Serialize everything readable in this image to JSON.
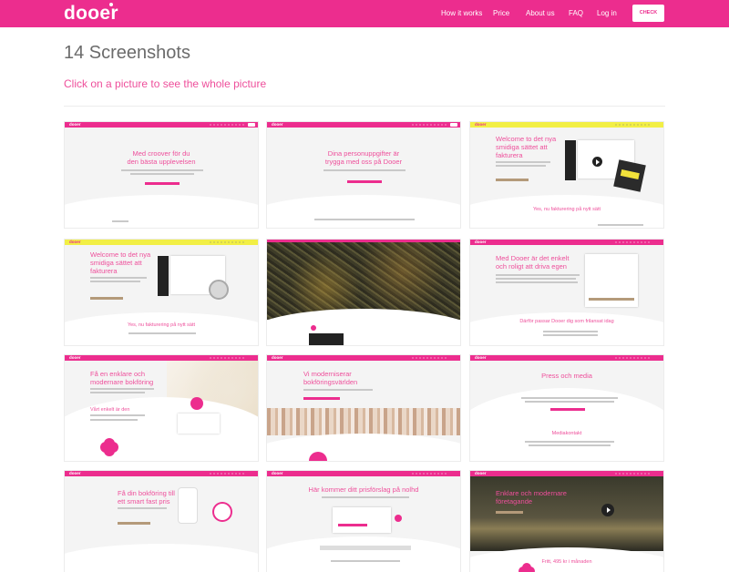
{
  "header": {
    "logo": "dooer",
    "nav": [
      "How it works",
      "Price",
      "About us",
      "FAQ",
      "Log in"
    ],
    "cta": "CHECK"
  },
  "page": {
    "title": "14 Screenshots",
    "subtitle": "Click on a picture to see the whole picture"
  },
  "screenshots": [
    {
      "logo": "dooer",
      "heading": [
        "Med croover för du",
        "den bästa upplevelsen"
      ]
    },
    {
      "logo": "dooer",
      "heading": [
        "Dina personuppgifter är",
        "trygga med oss på Dooer"
      ]
    },
    {
      "logo": "dooer",
      "heading": [
        "Welcome to det nya",
        "smidiga sättet att",
        "fakturera"
      ],
      "footer": "Yes, nu fakturering på nytt sätt"
    },
    {
      "logo": "dooer",
      "heading": [
        "Welcome to det nya",
        "smidiga sättet att",
        "fakturera"
      ],
      "footer": "Yes, nu fakturering på nytt sätt"
    },
    {
      "logo": "dooer",
      "heading": []
    },
    {
      "logo": "dooer",
      "heading": [
        "Med Dooer är det enkelt",
        "och roligt att driva egen"
      ],
      "footer": "Därför passar Dooer dig som frilansat idag"
    },
    {
      "logo": "dooer",
      "heading": [
        "Få en enklare och",
        "modernare bokföring"
      ],
      "footer": "Vårt enkelt är den"
    },
    {
      "logo": "dooer",
      "heading": [
        "Vi moderniserar",
        "bokföringsvärlden"
      ]
    },
    {
      "logo": "dooer",
      "heading": [
        "Press och media"
      ],
      "footer": "Mediakontakt"
    },
    {
      "logo": "dooer",
      "heading": [
        "Få din bokföring till",
        "ett smart fast pris"
      ]
    },
    {
      "logo": "dooer",
      "heading": [
        "Här kommer ditt prisförslag på nolhd"
      ]
    },
    {
      "logo": "dooer",
      "heading": [
        "Enklare och modernare",
        "företagande"
      ],
      "footer": "Fritt, 495 kr i månaden"
    }
  ]
}
